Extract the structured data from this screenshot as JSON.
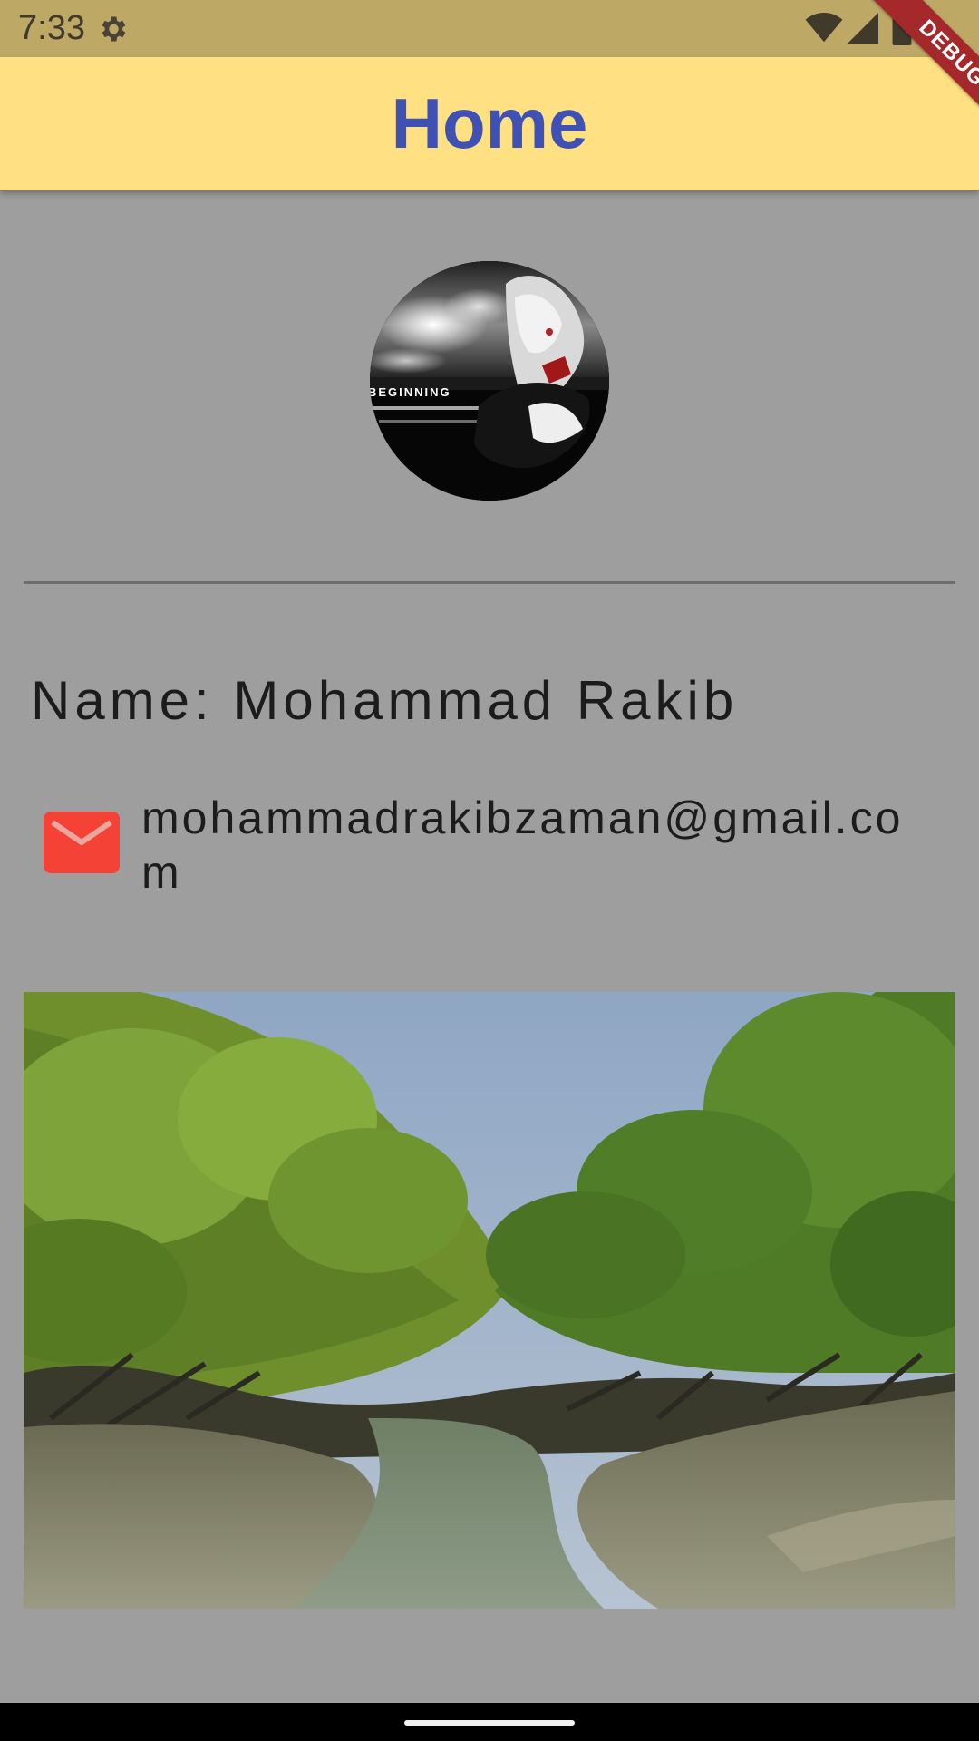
{
  "status_bar": {
    "time": "7:33",
    "icons": [
      "settings-icon",
      "wifi-icon",
      "signal-icon",
      "battery-icon"
    ]
  },
  "debug_banner": {
    "label": "DEBUG"
  },
  "app_bar": {
    "title": "Home"
  },
  "profile": {
    "avatar_caption": "BEGINNING",
    "name_label": "Name: Mohammad Rakib",
    "email": "mohammadrakibzaman@gmail.com"
  },
  "colors": {
    "status_bar": "#bda866",
    "app_bar": "#ffe082",
    "title": "#3f51b5",
    "background": "#9e9e9e",
    "mail_icon": "#f44336",
    "debug_ribbon": "#a5282a"
  },
  "icons": {
    "mail": "mail-icon",
    "home_indicator": "home-indicator"
  }
}
